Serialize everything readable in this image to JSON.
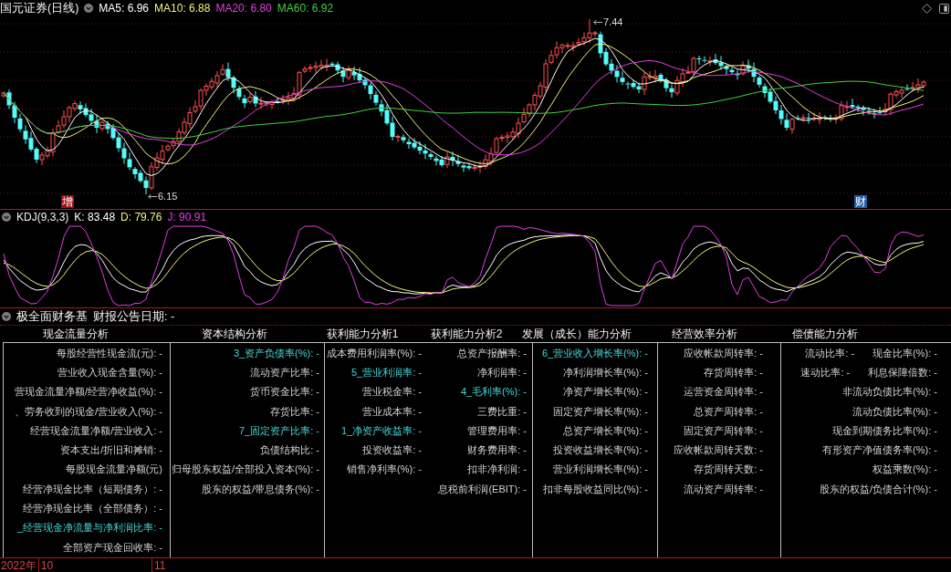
{
  "chart_header": {
    "title": "国元证券(日线)",
    "indicators": [
      {
        "label": "MA5: 6.96",
        "color": "#ffffff"
      },
      {
        "label": "MA10: 6.88",
        "color": "#f2f27a"
      },
      {
        "label": "MA20: 6.80",
        "color": "#e23ee2"
      },
      {
        "label": "MA60: 6.92",
        "color": "#3fd13f"
      }
    ]
  },
  "price_chart": {
    "high_label": "7.44",
    "low_label": "6.15",
    "markers": [
      {
        "text": "增",
        "color": "#a01010"
      },
      {
        "text": "财",
        "color": "#1c5fa8"
      }
    ]
  },
  "kdj": {
    "title": "KDJ(9,3,3)",
    "indicators": [
      {
        "label": "K: 83.48",
        "color": "#ffffff"
      },
      {
        "label": "D: 79.76",
        "color": "#f2f27a"
      },
      {
        "label": "J: 90.91",
        "color": "#e23ee2"
      }
    ]
  },
  "finance_panel": {
    "title": "极全面财务基",
    "report_date": "财报公告日期: -",
    "columns": [
      {
        "heading": "现金流量分析",
        "rows": [
          {
            "cells": [
              {
                "text": "每股经营性现金流(元): -",
                "highlighted": false
              }
            ]
          },
          {
            "cells": [
              {
                "text": "营业收入现金含量(%): -",
                "highlighted": false
              }
            ]
          },
          {
            "cells": [
              {
                "text": "营现金流量净额/经营净收益(%): -",
                "highlighted": false
              }
            ]
          },
          {
            "cells": [
              {
                "text": "、劳务收到的现金/营业收入(%): -",
                "highlighted": false
              }
            ]
          },
          {
            "cells": [
              {
                "text": "经营现金流量净额/营业收入: -",
                "highlighted": false
              }
            ]
          },
          {
            "cells": [
              {
                "text": "资本支出/折旧和摊销: -",
                "highlighted": false
              }
            ]
          },
          {
            "cells": [
              {
                "text": "每股现金流量净额(元)",
                "highlighted": false
              }
            ]
          },
          {
            "cells": [
              {
                "text": "经营净现金比率（短期债务）: -",
                "highlighted": false
              }
            ]
          },
          {
            "cells": [
              {
                "text": "经营净现金比率（全部债务）: -",
                "highlighted": false
              }
            ]
          },
          {
            "cells": [
              {
                "text": "_经营现金净流量与净利润比率: -",
                "highlighted": true
              }
            ]
          },
          {
            "cells": [
              {
                "text": "全部资产现金回收率: -",
                "highlighted": false
              }
            ]
          }
        ]
      },
      {
        "heading": "资本结构分析",
        "rows": [
          {
            "cells": [
              {
                "text": "3_资产负债率(%): -",
                "highlighted": true
              }
            ]
          },
          {
            "cells": [
              {
                "text": "流动资产比率: -",
                "highlighted": false
              }
            ]
          },
          {
            "cells": [
              {
                "text": "货币资金比率: -",
                "highlighted": false
              }
            ]
          },
          {
            "cells": [
              {
                "text": "存货比率: -",
                "highlighted": false
              }
            ]
          },
          {
            "cells": [
              {
                "text": "7_固定资产比率: -",
                "highlighted": true
              }
            ]
          },
          {
            "cells": [
              {
                "text": "负债结构比: -",
                "highlighted": false
              }
            ]
          },
          {
            "cells": [
              {
                "text": "归母股东权益/全部投入资本(%): -",
                "highlighted": false
              }
            ]
          },
          {
            "cells": [
              {
                "text": "股东的权益/带息债务(%): -",
                "highlighted": false
              }
            ]
          }
        ]
      },
      {
        "heading": "获利能力分析1",
        "rows": [
          {
            "cells": [
              {
                "text": "成本费用利润率(%): -",
                "highlighted": false
              }
            ]
          },
          {
            "cells": [
              {
                "text": "5_营业利润率: -",
                "highlighted": true
              }
            ]
          },
          {
            "cells": [
              {
                "text": "营业税金率: -",
                "highlighted": false
              }
            ]
          },
          {
            "cells": [
              {
                "text": "营业成本率: -",
                "highlighted": false
              }
            ]
          },
          {
            "cells": [
              {
                "text": "1_净资产收益率: -",
                "highlighted": true
              }
            ]
          },
          {
            "cells": [
              {
                "text": "投资收益率: -",
                "highlighted": false
              }
            ]
          },
          {
            "cells": [
              {
                "text": "销售净利率(%): -",
                "highlighted": false
              }
            ]
          }
        ]
      },
      {
        "heading": "获利能力分析2",
        "rows": [
          {
            "cells": [
              {
                "text": "总资产报酬率: -",
                "highlighted": false
              }
            ]
          },
          {
            "cells": [
              {
                "text": "净利润率: -",
                "highlighted": false
              }
            ]
          },
          {
            "cells": [
              {
                "text": "4_毛利率(%): -",
                "highlighted": true
              }
            ]
          },
          {
            "cells": [
              {
                "text": "三费比重: -",
                "highlighted": false
              }
            ]
          },
          {
            "cells": [
              {
                "text": "管理费用率: -",
                "highlighted": false
              }
            ]
          },
          {
            "cells": [
              {
                "text": "财务费用率: -",
                "highlighted": false
              }
            ]
          },
          {
            "cells": [
              {
                "text": "扣非净利润: -",
                "highlighted": false
              }
            ]
          },
          {
            "cells": [
              {
                "text": "息税前利润(EBIT): -",
                "highlighted": false
              }
            ]
          }
        ]
      },
      {
        "heading": "发展（成长）能力分析",
        "rows": [
          {
            "cells": [
              {
                "text": "6_营业收入增长率(%): -",
                "highlighted": true
              }
            ]
          },
          {
            "cells": [
              {
                "text": "净利润增长率(%): -",
                "highlighted": false
              }
            ]
          },
          {
            "cells": [
              {
                "text": "净资产增长率(%): -",
                "highlighted": false
              }
            ]
          },
          {
            "cells": [
              {
                "text": "固定资产增长率(%): -",
                "highlighted": false
              }
            ]
          },
          {
            "cells": [
              {
                "text": "总资产增长率(%): -",
                "highlighted": false
              }
            ]
          },
          {
            "cells": [
              {
                "text": "投资收益增长率(%): -",
                "highlighted": false
              }
            ]
          },
          {
            "cells": [
              {
                "text": "营业利润增长率(%): -",
                "highlighted": false
              }
            ]
          },
          {
            "cells": [
              {
                "text": "扣非每股收益同比(%): -",
                "highlighted": false
              }
            ]
          }
        ]
      },
      {
        "heading": "经营效率分析",
        "rows": [
          {
            "cells": [
              {
                "text": "应收帐款周转率: -",
                "highlighted": false
              }
            ]
          },
          {
            "cells": [
              {
                "text": "存货周转率: -",
                "highlighted": false
              }
            ]
          },
          {
            "cells": [
              {
                "text": "运营资金周转率: -",
                "highlighted": false
              }
            ]
          },
          {
            "cells": [
              {
                "text": "总资产周转率: -",
                "highlighted": false
              }
            ]
          },
          {
            "cells": [
              {
                "text": "固定资产周转率: -",
                "highlighted": false
              }
            ]
          },
          {
            "cells": [
              {
                "text": "应收帐款周转天数: -",
                "highlighted": false
              }
            ]
          },
          {
            "cells": [
              {
                "text": "存货周转天数: -",
                "highlighted": false
              }
            ]
          },
          {
            "cells": [
              {
                "text": "流动资产周转率: -",
                "highlighted": false
              }
            ]
          }
        ]
      },
      {
        "heading": "偿债能力分析",
        "rows": [
          {
            "cells": [
              {
                "text": "流动比率: -",
                "highlighted": false
              },
              {
                "text": "现金比率(%): -",
                "highlighted": false
              }
            ]
          },
          {
            "cells": [
              {
                "text": "速动比率: -",
                "highlighted": false
              },
              {
                "text": "利息保障倍数: -",
                "highlighted": false
              }
            ]
          },
          {
            "cells": [
              {
                "text": "非流动负债比率(%): -",
                "highlighted": false
              }
            ]
          },
          {
            "cells": [
              {
                "text": "流动负债比率(%): -",
                "highlighted": false
              }
            ]
          },
          {
            "cells": [
              {
                "text": "现金到期债务比率(%): -",
                "highlighted": false
              }
            ]
          },
          {
            "cells": [
              {
                "text": "有形资产净值债务率(%): -",
                "highlighted": false
              }
            ]
          },
          {
            "cells": [
              {
                "text": "权益乘数(%): -",
                "highlighted": false
              }
            ]
          },
          {
            "cells": [
              {
                "text": "股东的权益/负债合计(%): -",
                "highlighted": false
              }
            ]
          }
        ]
      }
    ]
  },
  "time_axis": [
    {
      "year": "2022年",
      "month": "10"
    },
    {
      "month": "11"
    }
  ]
}
